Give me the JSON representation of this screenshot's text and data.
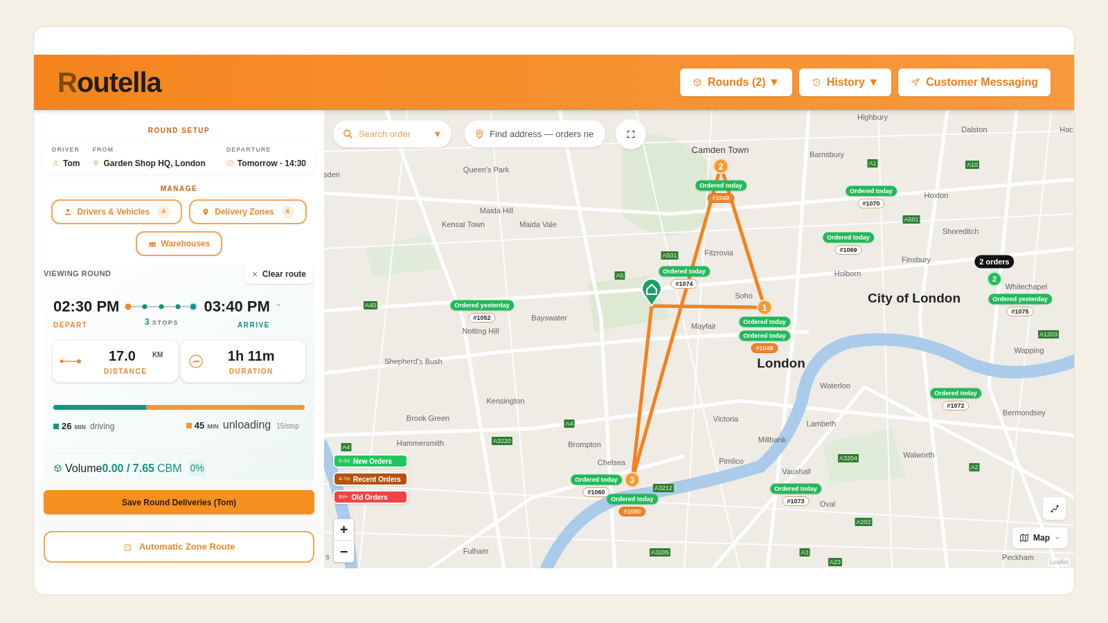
{
  "header": {
    "logo": "Routella",
    "buttons": [
      {
        "label": "Rounds (2)",
        "caret": "▼",
        "kind": "rounds"
      },
      {
        "label": "History",
        "caret": "▼",
        "kind": "history"
      },
      {
        "label": "Customer Messaging",
        "kind": "messaging"
      }
    ]
  },
  "round_setup": {
    "title": "ROUND SETUP",
    "fields": [
      {
        "label": "DRIVER",
        "value": "Tom",
        "kind": "driver"
      },
      {
        "label": "FROM",
        "value": "Garden Shop HQ, London",
        "kind": "from"
      },
      {
        "label": "DEPARTURE",
        "value": "Tomorrow · 14:30",
        "kind": "departure"
      }
    ]
  },
  "manage": {
    "title": "MANAGE",
    "buttons": [
      {
        "label": "Drivers & Vehicles",
        "count": "4",
        "kind": "drivers"
      },
      {
        "label": "Delivery Zones",
        "count": "6",
        "kind": "zones"
      },
      {
        "label": "Warehouses",
        "kind": "warehouses"
      }
    ]
  },
  "viewing_round": {
    "title": "VIEWING ROUND",
    "clear_button": "Clear route",
    "depart_time": "02:30 PM",
    "depart_label": "DEPART",
    "stops_count": "3",
    "stops_label": "STOPS",
    "arrive_time": "03:40 PM",
    "arrive_label": "ARRIVE",
    "distance": {
      "value": "17.0",
      "unit": "KM",
      "label": "DISTANCE"
    },
    "duration": {
      "value": "1h 11m",
      "label": "DURATION"
    },
    "time_split": {
      "level": 0.37
    },
    "driving": {
      "value": "26",
      "unit": "MIN",
      "label": "driving"
    },
    "unloading": {
      "value": "45",
      "unit": "MIN",
      "label": "unloading",
      "note": "15/stop"
    },
    "volume": {
      "label": "Volume",
      "value": "0.00 / 7.65",
      "unit": "CBM",
      "percent": "0%"
    }
  },
  "actions": [
    {
      "label": "Save Round Deliveries (Tom)",
      "kind": "primary"
    },
    {
      "label": "Automatic Zone Route",
      "kind": "outline"
    }
  ],
  "map": {
    "search": {
      "placeholder": "Search order",
      "caret": "▼"
    },
    "address_search": {
      "placeholder": "Find address — orders ne"
    },
    "place_labels": [
      {
        "text": "Highbury",
        "kind": "place"
      },
      {
        "text": "Dalston",
        "kind": "place"
      },
      {
        "text": "Hac",
        "kind": "place"
      },
      {
        "text": "Camden Town",
        "kind": "major"
      },
      {
        "text": "Barnsbury",
        "kind": "place"
      },
      {
        "text": "Queen's Park",
        "kind": "place"
      },
      {
        "text": "sden",
        "kind": "place"
      },
      {
        "text": "Hoxton",
        "kind": "place"
      },
      {
        "text": "Maida Hill",
        "kind": "place"
      },
      {
        "text": "Kensal Town",
        "kind": "place"
      },
      {
        "text": "Maida Vale",
        "kind": "place"
      },
      {
        "text": "Shoreditch",
        "kind": "place"
      },
      {
        "text": "Fitzrovia",
        "kind": "place"
      },
      {
        "text": "Finsbury",
        "kind": "place"
      },
      {
        "text": "Holborn",
        "kind": "place"
      },
      {
        "text": "Whitechapel",
        "kind": "place"
      },
      {
        "text": "Soho",
        "kind": "place"
      },
      {
        "text": "City of London",
        "kind": "city"
      },
      {
        "text": "Bayswater",
        "kind": "place"
      },
      {
        "text": "Notting Hill",
        "kind": "place"
      },
      {
        "text": "Mayfair",
        "kind": "place"
      },
      {
        "text": "Wapping",
        "kind": "place"
      },
      {
        "text": "London",
        "kind": "city"
      },
      {
        "text": "Shepherd's Bush",
        "kind": "place"
      },
      {
        "text": "Waterloo",
        "kind": "place"
      },
      {
        "text": "Kensington",
        "kind": "place"
      },
      {
        "text": "Bermondsey",
        "kind": "place"
      },
      {
        "text": "Brook Green",
        "kind": "place"
      },
      {
        "text": "Victoria",
        "kind": "place"
      },
      {
        "text": "Lambeth",
        "kind": "place"
      },
      {
        "text": "Millbank",
        "kind": "place"
      },
      {
        "text": "Hammersmith",
        "kind": "place"
      },
      {
        "text": "Brompton",
        "kind": "place"
      },
      {
        "text": "Walworth",
        "kind": "place"
      },
      {
        "text": "Pimlico",
        "kind": "place"
      },
      {
        "text": "Chelsea",
        "kind": "place"
      },
      {
        "text": "Vauxhall",
        "kind": "place"
      },
      {
        "text": "Oval",
        "kind": "place"
      },
      {
        "text": "Fulham",
        "kind": "place"
      },
      {
        "text": "Peckham",
        "kind": "place"
      },
      {
        "text": "s",
        "kind": "place"
      }
    ],
    "road_labels": [
      "A501",
      "A5",
      "A40",
      "A1",
      "A10",
      "A501",
      "A1203",
      "A4",
      "A3220",
      "A4",
      "A3212",
      "A3205",
      "A3204",
      "A2",
      "A202",
      "A3",
      "A23"
    ],
    "stops": [
      {
        "number": "2"
      },
      {
        "number": "1"
      },
      {
        "number": "3"
      }
    ],
    "orders": [
      {
        "label": "Ordered today",
        "number": "#1049",
        "on_route": true
      },
      {
        "label": "Ordered today",
        "number": "#1070",
        "on_route": false
      },
      {
        "label": "Ordered today",
        "number": "#1069",
        "on_route": false
      },
      {
        "label": "Ordered today",
        "number": "#1074",
        "on_route": false
      },
      {
        "label": "Ordered yesterday",
        "number": "#1052",
        "on_route": false
      },
      {
        "label": "Ordered today"
      },
      {
        "label": "Ordered today",
        "number": "#1048",
        "on_route": true
      },
      {
        "label": "Ordered yesterday",
        "number": "#1075",
        "on_route": false
      },
      {
        "label": "Ordered today",
        "number": "#1072",
        "on_route": false
      },
      {
        "label": "Ordered today",
        "number": "#1073",
        "on_route": false
      },
      {
        "label": "Ordered today",
        "number": "#1060",
        "on_route": false
      },
      {
        "label": "Ordered today",
        "number": "#1050",
        "on_route": true
      }
    ],
    "cluster": {
      "count": "2",
      "tooltip": "2 orders"
    },
    "legend": [
      {
        "range": "0-3d",
        "label": "New Orders",
        "color": "#22c55e"
      },
      {
        "range": "4-7d",
        "label": "Recent Orders",
        "color": "#b45309"
      },
      {
        "range": "8d+",
        "label": "Old Orders",
        "color": "#ef4444"
      }
    ],
    "zoom_in": "+",
    "zoom_out": "−",
    "layer_button": "Map",
    "attribution": "Leaflet"
  }
}
